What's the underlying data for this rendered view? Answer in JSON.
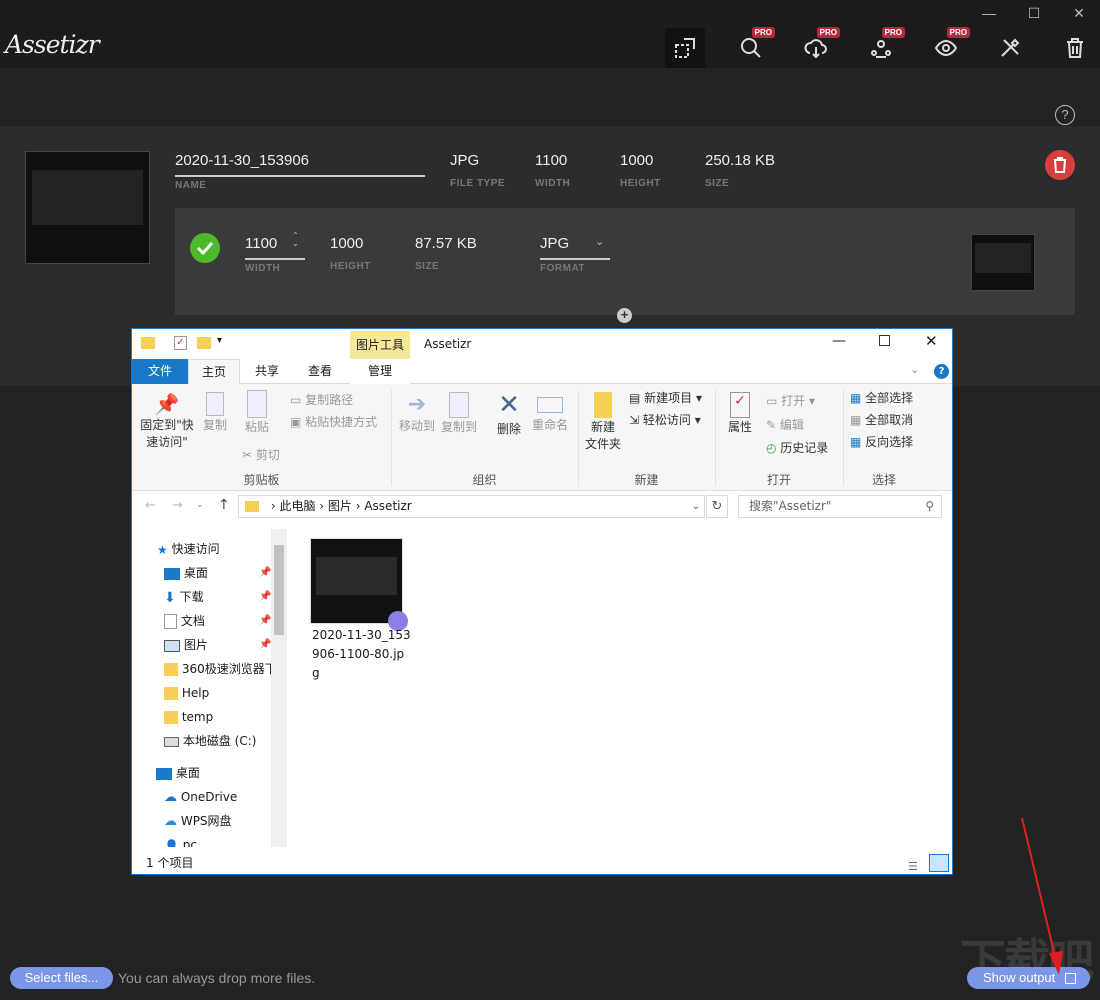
{
  "app": {
    "logo": "Assetizr",
    "help": "?"
  },
  "toolbar": {
    "pro_badge": "PRO",
    "tools": [
      "resize-icon",
      "search-icon",
      "cloud-download-icon",
      "team-icon",
      "eye-icon",
      "tools-icon",
      "trash-icon"
    ]
  },
  "window_controls": {
    "minimize": "—",
    "maximize": "☐",
    "close": "✕"
  },
  "file": {
    "name": "2020-11-30_153906",
    "name_label": "NAME",
    "type": "JPG",
    "type_label": "FILE TYPE",
    "width": "1100",
    "width_label": "WIDTH",
    "height": "1000",
    "height_label": "HEIGHT",
    "size": "250.18 KB",
    "size_label": "SIZE"
  },
  "output": {
    "width": "1100",
    "width_label": "WIDTH",
    "height": "1000",
    "height_label": "HEIGHT",
    "size": "87.57 KB",
    "size_label": "SIZE",
    "format": "JPG",
    "format_label": "FORMAT"
  },
  "explorer": {
    "title": "Assetizr",
    "context_tab": "图片工具",
    "tabs": {
      "file": "文件",
      "home": "主页",
      "share": "共享",
      "view": "查看",
      "manage": "管理"
    },
    "ribbon": {
      "pin": "固定到\"快\n速访问\"",
      "copy": "复制",
      "paste": "粘贴",
      "copy_path": "复制路径",
      "paste_shortcut": "粘贴快捷方式",
      "cut": "剪切",
      "move_to": "移动到",
      "copy_to": "复制到",
      "delete": "删除",
      "rename": "重命名",
      "new_folder": "新建\n文件夹",
      "new_item": "新建项目",
      "easy_access": "轻松访问",
      "properties": "属性",
      "open": "打开",
      "edit": "编辑",
      "history": "历史记录",
      "select_all": "全部选择",
      "select_none": "全部取消",
      "invert": "反向选择",
      "groups": {
        "clipboard": "剪贴板",
        "organize": "组织",
        "new": "新建",
        "open": "打开",
        "select": "选择"
      }
    },
    "path": [
      "此电脑",
      "图片",
      "Assetizr"
    ],
    "search_placeholder": "搜索\"Assetizr\"",
    "nav": [
      "快速访问",
      "桌面",
      "下载",
      "文档",
      "图片",
      "360极速浏览器下",
      "Help",
      "temp",
      "本地磁盘 (C:)",
      "桌面",
      "OneDrive",
      "WPS网盘",
      "pc"
    ],
    "file_name": "2020-11-30_153906-1100-80.jpg",
    "file_name_lines": [
      "2020-11-30_153",
      "906-1100-80.jp",
      "g"
    ],
    "status": "1 个项目"
  },
  "bottom": {
    "select_files": "Select files...",
    "drop_hint": "You can always drop more files.",
    "show_output": "Show output"
  },
  "watermark": "下载吧",
  "colors": {
    "accent": "#7c97e8",
    "delete": "#d84040",
    "success": "#4db82a",
    "pro": "#b8283e"
  }
}
